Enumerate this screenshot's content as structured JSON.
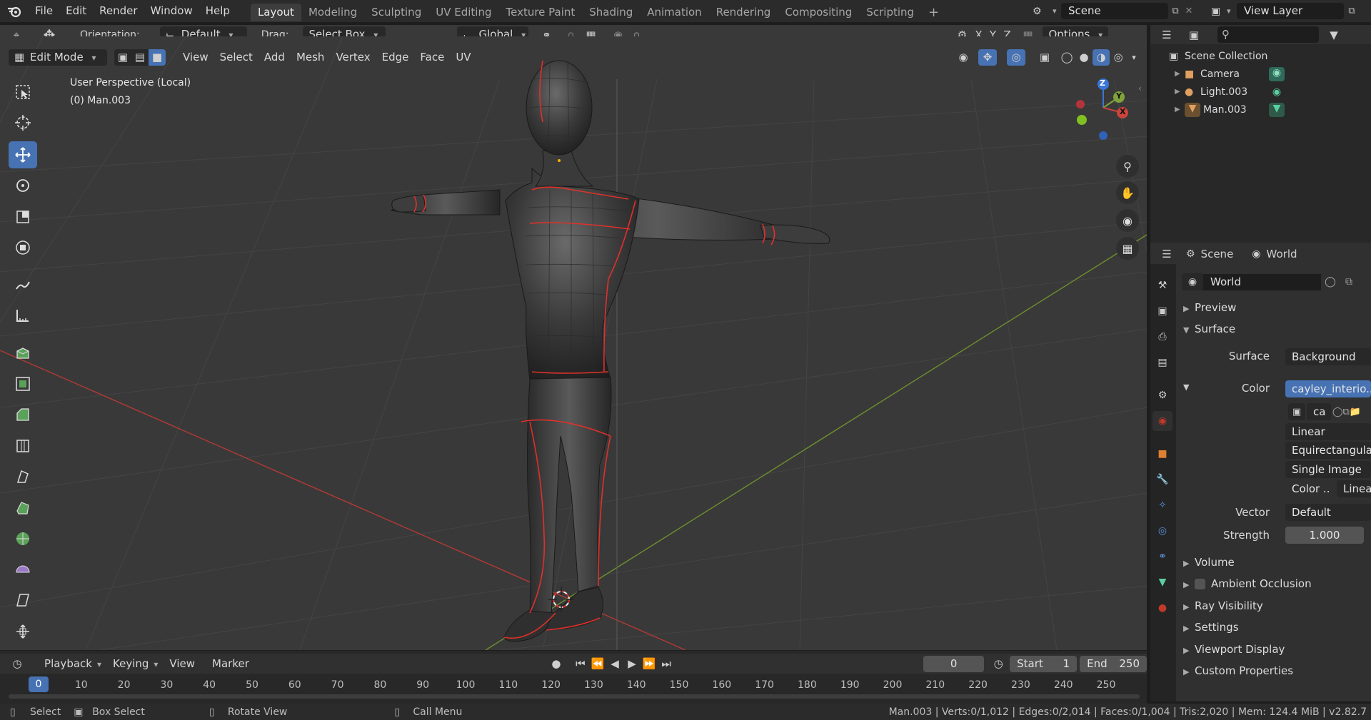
{
  "menu": [
    "File",
    "Edit",
    "Render",
    "Window",
    "Help"
  ],
  "workspaces": [
    "Layout",
    "Modeling",
    "Sculpting",
    "UV Editing",
    "Texture Paint",
    "Shading",
    "Animation",
    "Rendering",
    "Compositing",
    "Scripting"
  ],
  "active_workspace": "Layout",
  "add_workspace": "+",
  "scene": {
    "name": "Scene"
  },
  "view_layer": {
    "name": "View Layer"
  },
  "tool_header": {
    "orientation_label": "Orientation:",
    "orientation_value": "Default",
    "drag_label": "Drag:",
    "drag_value": "Select Box",
    "transform_orientation": "Global",
    "options": "Options",
    "axes": [
      "X",
      "Y",
      "Z"
    ]
  },
  "view_header": {
    "mode": "Edit Mode",
    "menus": [
      "View",
      "Select",
      "Add",
      "Mesh",
      "Vertex",
      "Edge",
      "Face",
      "UV"
    ]
  },
  "viewport": {
    "perspective": "User Perspective (Local)",
    "object": "(0) Man.003",
    "gizmo_axes": [
      "Z",
      "Y",
      "X"
    ]
  },
  "outliner": {
    "root": "Scene Collection",
    "items": [
      {
        "name": "Camera",
        "icon": "camera-icon",
        "data_icon": "camera-data-icon"
      },
      {
        "name": "Light.003",
        "icon": "light-icon",
        "data_icon": "light-data-icon"
      },
      {
        "name": "Man.003",
        "icon": "mesh-object-icon",
        "data_icon": "mesh-data-icon"
      }
    ]
  },
  "properties": {
    "context_scene": "Scene",
    "context_world": "World",
    "world_name": "World",
    "panels": {
      "preview": "Preview",
      "surface": "Surface",
      "volume": "Volume",
      "ambient_occlusion": "Ambient Occlusion",
      "ray_visibility": "Ray Visibility",
      "settings": "Settings",
      "viewport_display": "Viewport Display",
      "custom_properties": "Custom Properties"
    },
    "surface_label": "Surface",
    "surface_value": "Background",
    "color_label": "Color",
    "color_value": "cayley_interio...",
    "image_short": "ca",
    "interpolation": "Linear",
    "projection": "Equirectangular",
    "source": "Single Image",
    "color_space_label": "Color ..",
    "color_space_value": "Linea",
    "vector_label": "Vector",
    "vector_value": "Default",
    "strength_label": "Strength",
    "strength_value": "1.000"
  },
  "timeline": {
    "menus": [
      "Playback",
      "Keying",
      "View",
      "Marker"
    ],
    "current_frame": "0",
    "start_label": "Start",
    "start_value": "1",
    "end_label": "End",
    "end_value": "250",
    "ruler_current": "0",
    "ticks": [
      "10",
      "20",
      "30",
      "40",
      "50",
      "60",
      "70",
      "80",
      "90",
      "100",
      "110",
      "120",
      "130",
      "140",
      "150",
      "160",
      "170",
      "180",
      "190",
      "200",
      "210",
      "220",
      "230",
      "240",
      "250"
    ]
  },
  "status": {
    "select": "Select",
    "box_select": "Box Select",
    "rotate_view": "Rotate View",
    "call_menu": "Call Menu",
    "stats": "Man.003 | Verts:0/1,012 | Edges:0/2,014 | Faces:0/1,004 | Tris:2,020 | Mem: 124.4 MiB | v2.82.7"
  },
  "colors": {
    "active_blue": "#4772b3",
    "seam_red": "#e0302a",
    "x_axis": "#c8443c",
    "y_axis": "#7fa33a",
    "z_axis": "#3a76d8",
    "world_red": "#c0392b"
  }
}
